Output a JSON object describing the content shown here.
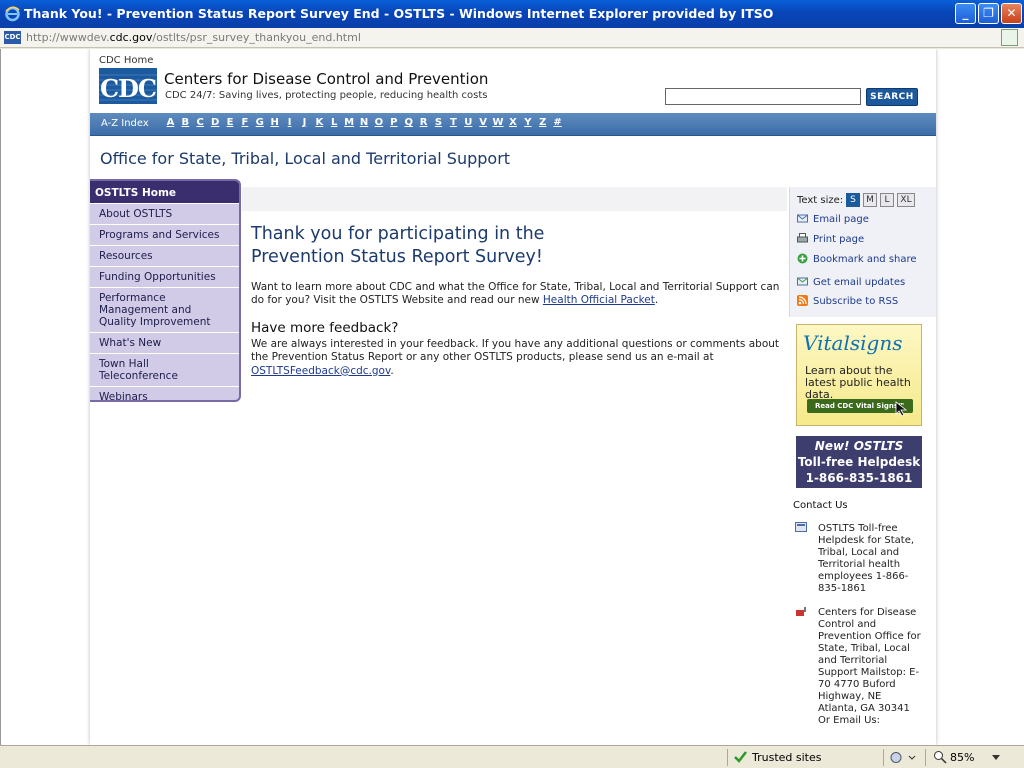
{
  "window": {
    "title": "Thank You! - Prevention Status Report Survey End - OSTLTS - Windows Internet Explorer provided by ITSO",
    "min_label": "_",
    "max_label": "❐",
    "close_label": "✕"
  },
  "address": {
    "icon_label": "CDC",
    "url_prefix": "http://wwwdev.",
    "url_domain": "cdc.gov",
    "url_path": "/ostlts/psr_survey_thankyou_end.html"
  },
  "header": {
    "cdc_home": "CDC Home",
    "logo_text": "CDC",
    "org_name": "Centers for Disease Control and Prevention",
    "tagline": "CDC 24/7: Saving lives, protecting people, reducing health costs",
    "search_value": "",
    "search_button": "SEARCH"
  },
  "az": {
    "label": "A-Z Index",
    "letters": [
      "A",
      "B",
      "C",
      "D",
      "E",
      "F",
      "G",
      "H",
      "I",
      "J",
      "K",
      "L",
      "M",
      "N",
      "O",
      "P",
      "Q",
      "R",
      "S",
      "T",
      "U",
      "V",
      "W",
      "X",
      "Y",
      "Z",
      "#"
    ]
  },
  "office_title": "Office for State, Tribal, Local and Territorial Support",
  "nav": {
    "home": "OSTLTS Home",
    "items": [
      "About OSTLTS",
      "Programs and Services",
      "Resources",
      "Funding Opportunities",
      "Performance Management and Quality Improvement",
      "What's New",
      "Town Hall Teleconference",
      "Webinars"
    ]
  },
  "main": {
    "title": "Thank you for participating in the Prevention Status Report Survey!",
    "intro": "Want to learn more about CDC and what the Office for State, Tribal, Local and Territorial Support can do for you? Visit the OSTLTS Website and read our new ",
    "intro_link": "Health Official Packet",
    "intro_end": ".",
    "feedback_head": "Have more feedback?",
    "feedback": "We are always interested in your feedback. If you have any additional questions or comments about the Prevention Status Report or any other OSTLTS products, please send us an e-mail at ",
    "feedback_link": "OSTLTSFeedback@cdc.gov",
    "feedback_end": "."
  },
  "tools": {
    "text_size_label": "Text size:",
    "sizes": [
      "S",
      "M",
      "L",
      "XL"
    ],
    "email": "Email page",
    "print": "Print page",
    "bookmark": "Bookmark and share",
    "updates": "Get email updates",
    "rss": "Subscribe to RSS"
  },
  "vital": {
    "brand_a": "Vital",
    "brand_b": "signs",
    "tag": "Learn about the latest public health data.",
    "button": "Read CDC Vital Signs™"
  },
  "helpdesk": {
    "line1": "New! OSTLTS",
    "line2": "Toll-free Helpdesk",
    "line3": "1-866-835-1861"
  },
  "contact": {
    "head": "Contact Us",
    "phone_block": "OSTLTS Toll-free Helpdesk for State, Tribal, Local and Territorial health employees 1-866-835-1861",
    "mail_block": "Centers for Disease Control and Prevention Office for State, Tribal, Local and Territorial Support Mailstop: E-70 4770 Buford Highway, NE Atlanta, GA 30341 Or Email Us:"
  },
  "status": {
    "zone": "Trusted sites",
    "zoom": "85%"
  },
  "colors": {
    "titlebar": "#0845b8",
    "cdc_blue": "#1d5a9d",
    "nav_dark": "#3a2e6e",
    "nav_light": "#d2cbe8"
  }
}
